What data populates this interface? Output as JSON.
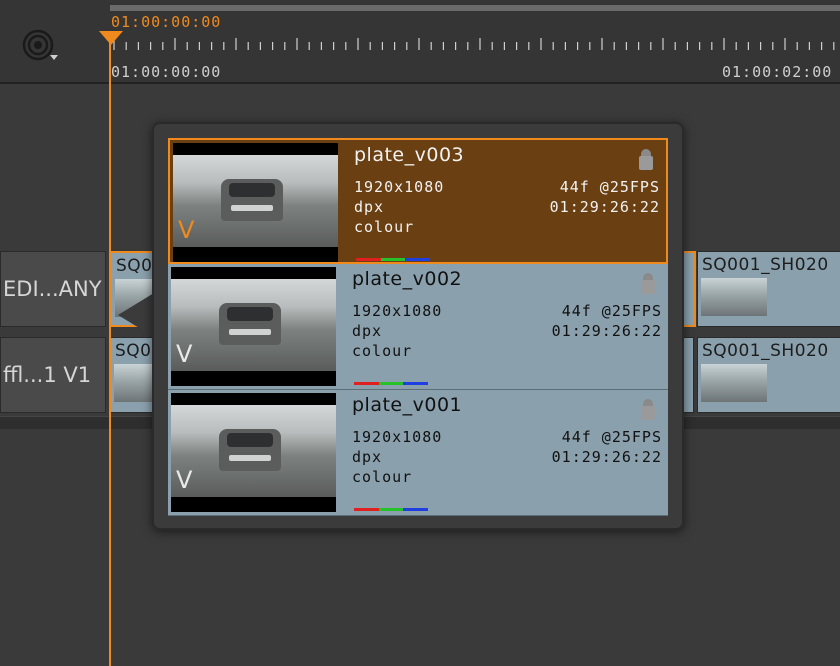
{
  "timeline": {
    "current_timecode": "01:00:00:00",
    "ruler_start": "01:00:00:00",
    "ruler_end": "01:00:02:00"
  },
  "tracks": [
    {
      "label": "EDI...ANY",
      "clips": [
        {
          "label": "SQ0"
        },
        {
          "label": "SQ001_SH020"
        }
      ]
    },
    {
      "label": "ffl...1 V1",
      "clips": [
        {
          "label": "SQ0"
        },
        {
          "label": "SQ001_SH020"
        }
      ]
    }
  ],
  "versions": [
    {
      "name": "plate_v003",
      "resolution": "1920x1080",
      "format": "dpx",
      "colour": "colour",
      "frames": "44f @25FPS",
      "timecode": "01:29:26:22",
      "badge": "V",
      "selected": true
    },
    {
      "name": "plate_v002",
      "resolution": "1920x1080",
      "format": "dpx",
      "colour": "colour",
      "frames": "44f @25FPS",
      "timecode": "01:29:26:22",
      "badge": "V",
      "selected": false
    },
    {
      "name": "plate_v001",
      "resolution": "1920x1080",
      "format": "dpx",
      "colour": "colour",
      "frames": "44f @25FPS",
      "timecode": "01:29:26:22",
      "badge": "V",
      "selected": false
    }
  ],
  "colors": {
    "accent": "#f08a1c",
    "clip": "#8aa0ad",
    "selected_bg": "#6a3f12",
    "channel_red": "#e0201e",
    "channel_green": "#25c22a",
    "channel_blue": "#1f3fe0"
  }
}
